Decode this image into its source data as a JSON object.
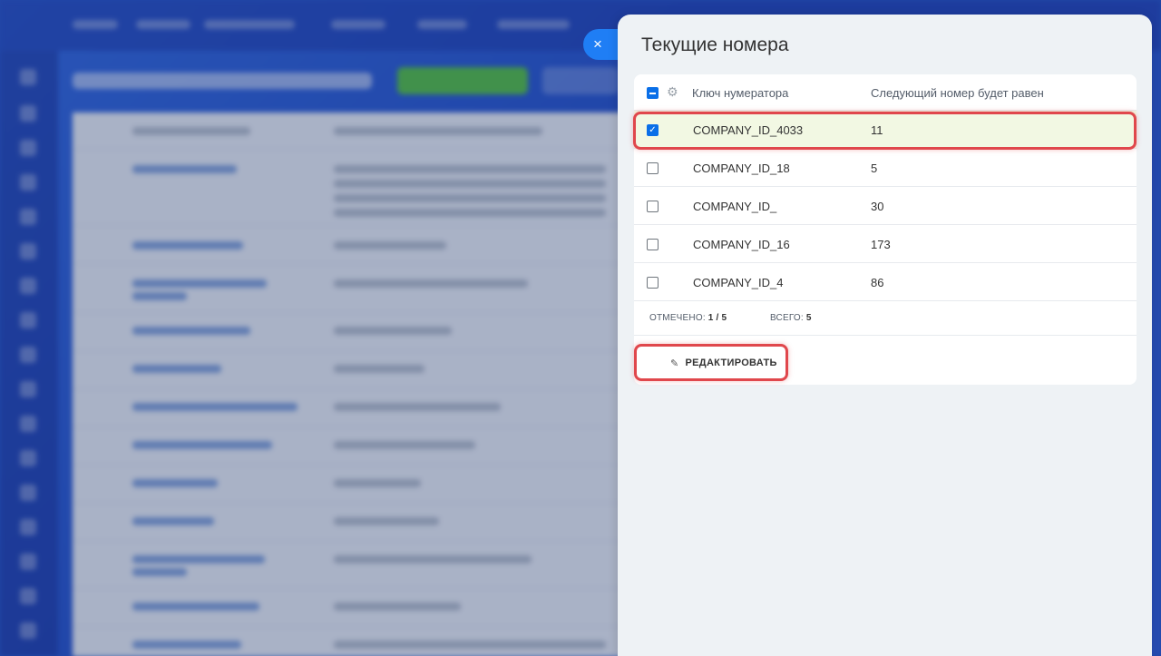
{
  "panel": {
    "title": "Текущие номера",
    "close_icon": "×"
  },
  "grid": {
    "columns": {
      "key": "Ключ нумератора",
      "next": "Следующий номер будет равен"
    },
    "rows": [
      {
        "key": "COMPANY_ID_4033",
        "next": "11",
        "checked": true
      },
      {
        "key": "COMPANY_ID_18",
        "next": "5",
        "checked": false
      },
      {
        "key": "COMPANY_ID_",
        "next": "30",
        "checked": false
      },
      {
        "key": "COMPANY_ID_16",
        "next": "173",
        "checked": false
      },
      {
        "key": "COMPANY_ID_4",
        "next": "86",
        "checked": false
      }
    ],
    "footer": {
      "selected_label": "ОТМЕЧЕНО:",
      "selected_value": "1 / 5",
      "total_label": "ВСЕГО:",
      "total_value": "5"
    }
  },
  "actions": {
    "edit_label": "РЕДАКТИРОВАТЬ"
  },
  "colors": {
    "accent": "#0a6fe8",
    "highlight": "#e0474c",
    "selected_row": "#f2f8e3",
    "close_button": "#1f7ef5"
  },
  "icons": {
    "close": "close-icon",
    "settings": "gear-icon",
    "edit": "pencil-icon"
  }
}
